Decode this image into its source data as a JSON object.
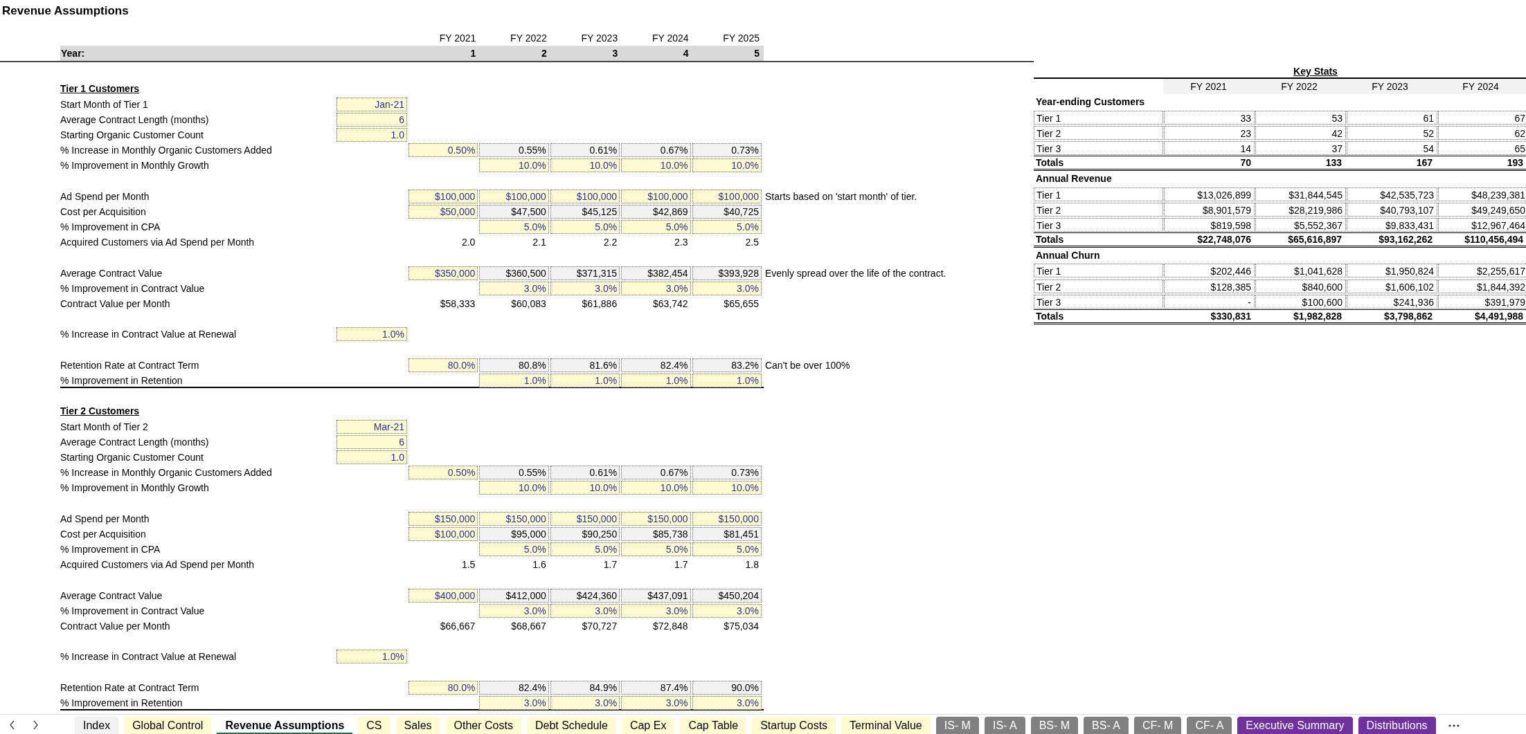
{
  "title": "Revenue Assumptions",
  "header": {
    "year_label": "Year:",
    "columns": [
      {
        "fy": "FY 2021",
        "year": "1"
      },
      {
        "fy": "FY 2022",
        "year": "2"
      },
      {
        "fy": "FY 2023",
        "year": "3"
      },
      {
        "fy": "FY 2024",
        "year": "4"
      },
      {
        "fy": "FY 2025",
        "year": "5"
      }
    ]
  },
  "sections": [
    {
      "title": "Tier 1 Customers",
      "groups": [
        [
          {
            "kind": "setting",
            "label": "Start Month of Tier 1",
            "setting": {
              "text": "Jan-21",
              "kind": "input"
            }
          },
          {
            "kind": "setting",
            "label": "Average Contract Length (months)",
            "setting": {
              "text": "6",
              "kind": "input"
            }
          },
          {
            "kind": "setting",
            "label": "Starting Organic Customer Count",
            "setting": {
              "text": "1.0",
              "kind": "input"
            }
          },
          {
            "kind": "series",
            "label": "% Increase in Monthly Organic Customers Added",
            "values": [
              {
                "text": "0.50%",
                "kind": "input"
              },
              {
                "text": "0.55%",
                "kind": "formula"
              },
              {
                "text": "0.61%",
                "kind": "formula"
              },
              {
                "text": "0.67%",
                "kind": "formula"
              },
              {
                "text": "0.73%",
                "kind": "formula"
              }
            ]
          },
          {
            "kind": "growth",
            "label": "% Improvement in Monthly Growth",
            "values": [
              {
                "text": "10.0%",
                "kind": "input"
              },
              {
                "text": "10.0%",
                "kind": "input"
              },
              {
                "text": "10.0%",
                "kind": "input"
              },
              {
                "text": "10.0%",
                "kind": "input"
              }
            ]
          }
        ],
        [
          {
            "kind": "series",
            "label": "Ad Spend per Month",
            "values": [
              {
                "text": "$100,000",
                "kind": "input"
              },
              {
                "text": "$100,000",
                "kind": "input"
              },
              {
                "text": "$100,000",
                "kind": "input"
              },
              {
                "text": "$100,000",
                "kind": "input"
              },
              {
                "text": "$100,000",
                "kind": "input"
              }
            ],
            "note": "Starts based on 'start month' of tier."
          },
          {
            "kind": "series",
            "label": "Cost per Acquisition",
            "values": [
              {
                "text": "$50,000",
                "kind": "input"
              },
              {
                "text": "$47,500",
                "kind": "formula"
              },
              {
                "text": "$45,125",
                "kind": "formula"
              },
              {
                "text": "$42,869",
                "kind": "formula"
              },
              {
                "text": "$40,725",
                "kind": "formula"
              }
            ]
          },
          {
            "kind": "growth",
            "label": "% Improvement in CPA",
            "values": [
              {
                "text": "5.0%",
                "kind": "input"
              },
              {
                "text": "5.0%",
                "kind": "input"
              },
              {
                "text": "5.0%",
                "kind": "input"
              },
              {
                "text": "5.0%",
                "kind": "input"
              }
            ]
          },
          {
            "kind": "series",
            "label": "Acquired Customers via Ad Spend per Month",
            "values": [
              {
                "text": "2.0",
                "kind": "output"
              },
              {
                "text": "2.1",
                "kind": "output"
              },
              {
                "text": "2.2",
                "kind": "output"
              },
              {
                "text": "2.3",
                "kind": "output"
              },
              {
                "text": "2.5",
                "kind": "output"
              }
            ]
          }
        ],
        [
          {
            "kind": "series",
            "label": "Average Contract Value",
            "values": [
              {
                "text": "$350,000",
                "kind": "input"
              },
              {
                "text": "$360,500",
                "kind": "formula"
              },
              {
                "text": "$371,315",
                "kind": "formula"
              },
              {
                "text": "$382,454",
                "kind": "formula"
              },
              {
                "text": "$393,928",
                "kind": "formula"
              }
            ],
            "note": "Evenly spread over the life of the contract."
          },
          {
            "kind": "growth",
            "label": "% Improvement in Contract Value",
            "values": [
              {
                "text": "3.0%",
                "kind": "input"
              },
              {
                "text": "3.0%",
                "kind": "input"
              },
              {
                "text": "3.0%",
                "kind": "input"
              },
              {
                "text": "3.0%",
                "kind": "input"
              }
            ]
          },
          {
            "kind": "series",
            "label": "Contract Value per Month",
            "values": [
              {
                "text": "$58,333",
                "kind": "output"
              },
              {
                "text": "$60,083",
                "kind": "output"
              },
              {
                "text": "$61,886",
                "kind": "output"
              },
              {
                "text": "$63,742",
                "kind": "output"
              },
              {
                "text": "$65,655",
                "kind": "output"
              }
            ]
          }
        ],
        [
          {
            "kind": "setting",
            "label": "% Increase in Contract Value at Renewal",
            "setting": {
              "text": "1.0%",
              "kind": "input"
            }
          }
        ],
        [
          {
            "kind": "series",
            "label": "Retention Rate at Contract Term",
            "values": [
              {
                "text": "80.0%",
                "kind": "input"
              },
              {
                "text": "80.8%",
                "kind": "formula"
              },
              {
                "text": "81.6%",
                "kind": "formula"
              },
              {
                "text": "82.4%",
                "kind": "formula"
              },
              {
                "text": "83.2%",
                "kind": "formula"
              }
            ],
            "note": "Can't be over 100%"
          },
          {
            "kind": "growth",
            "label": "% Improvement in Retention",
            "values": [
              {
                "text": "1.0%",
                "kind": "input"
              },
              {
                "text": "1.0%",
                "kind": "input"
              },
              {
                "text": "1.0%",
                "kind": "input"
              },
              {
                "text": "1.0%",
                "kind": "input"
              }
            ]
          }
        ]
      ]
    },
    {
      "title": "Tier 2 Customers",
      "groups": [
        [
          {
            "kind": "setting",
            "label": "Start Month of Tier 2",
            "setting": {
              "text": "Mar-21",
              "kind": "input"
            }
          },
          {
            "kind": "setting",
            "label": "Average Contract Length (months)",
            "setting": {
              "text": "6",
              "kind": "input"
            }
          },
          {
            "kind": "setting",
            "label": "Starting Organic Customer Count",
            "setting": {
              "text": "1.0",
              "kind": "input"
            }
          },
          {
            "kind": "series",
            "label": "% Increase in Monthly Organic Customers Added",
            "values": [
              {
                "text": "0.50%",
                "kind": "input"
              },
              {
                "text": "0.55%",
                "kind": "formula"
              },
              {
                "text": "0.61%",
                "kind": "formula"
              },
              {
                "text": "0.67%",
                "kind": "formula"
              },
              {
                "text": "0.73%",
                "kind": "formula"
              }
            ]
          },
          {
            "kind": "growth",
            "label": "% Improvement in Monthly Growth",
            "values": [
              {
                "text": "10.0%",
                "kind": "input"
              },
              {
                "text": "10.0%",
                "kind": "input"
              },
              {
                "text": "10.0%",
                "kind": "input"
              },
              {
                "text": "10.0%",
                "kind": "input"
              }
            ]
          }
        ],
        [
          {
            "kind": "series",
            "label": "Ad Spend per Month",
            "values": [
              {
                "text": "$150,000",
                "kind": "input"
              },
              {
                "text": "$150,000",
                "kind": "input"
              },
              {
                "text": "$150,000",
                "kind": "input"
              },
              {
                "text": "$150,000",
                "kind": "input"
              },
              {
                "text": "$150,000",
                "kind": "input"
              }
            ]
          },
          {
            "kind": "series",
            "label": "Cost per Acquisition",
            "values": [
              {
                "text": "$100,000",
                "kind": "input"
              },
              {
                "text": "$95,000",
                "kind": "formula"
              },
              {
                "text": "$90,250",
                "kind": "formula"
              },
              {
                "text": "$85,738",
                "kind": "formula"
              },
              {
                "text": "$81,451",
                "kind": "formula"
              }
            ]
          },
          {
            "kind": "growth",
            "label": "% Improvement in CPA",
            "values": [
              {
                "text": "5.0%",
                "kind": "input"
              },
              {
                "text": "5.0%",
                "kind": "input"
              },
              {
                "text": "5.0%",
                "kind": "input"
              },
              {
                "text": "5.0%",
                "kind": "input"
              }
            ]
          },
          {
            "kind": "series",
            "label": "Acquired Customers via Ad Spend per Month",
            "values": [
              {
                "text": "1.5",
                "kind": "output"
              },
              {
                "text": "1.6",
                "kind": "output"
              },
              {
                "text": "1.7",
                "kind": "output"
              },
              {
                "text": "1.7",
                "kind": "output"
              },
              {
                "text": "1.8",
                "kind": "output"
              }
            ]
          }
        ],
        [
          {
            "kind": "series",
            "label": "Average Contract Value",
            "values": [
              {
                "text": "$400,000",
                "kind": "input"
              },
              {
                "text": "$412,000",
                "kind": "formula"
              },
              {
                "text": "$424,360",
                "kind": "formula"
              },
              {
                "text": "$437,091",
                "kind": "formula"
              },
              {
                "text": "$450,204",
                "kind": "formula"
              }
            ]
          },
          {
            "kind": "growth",
            "label": "% Improvement in Contract Value",
            "values": [
              {
                "text": "3.0%",
                "kind": "input"
              },
              {
                "text": "3.0%",
                "kind": "input"
              },
              {
                "text": "3.0%",
                "kind": "input"
              },
              {
                "text": "3.0%",
                "kind": "input"
              }
            ]
          },
          {
            "kind": "series",
            "label": "Contract Value per Month",
            "values": [
              {
                "text": "$66,667",
                "kind": "output"
              },
              {
                "text": "$68,667",
                "kind": "output"
              },
              {
                "text": "$70,727",
                "kind": "output"
              },
              {
                "text": "$72,848",
                "kind": "output"
              },
              {
                "text": "$75,034",
                "kind": "output"
              }
            ]
          }
        ],
        [
          {
            "kind": "setting",
            "label": "% Increase in Contract Value at Renewal",
            "setting": {
              "text": "1.0%",
              "kind": "input"
            }
          }
        ],
        [
          {
            "kind": "series",
            "label": "Retention Rate at Contract Term",
            "values": [
              {
                "text": "80.0%",
                "kind": "input"
              },
              {
                "text": "82.4%",
                "kind": "formula"
              },
              {
                "text": "84.9%",
                "kind": "formula"
              },
              {
                "text": "87.4%",
                "kind": "formula"
              },
              {
                "text": "90.0%",
                "kind": "formula"
              }
            ]
          },
          {
            "kind": "growth",
            "label": "% Improvement in Retention",
            "values": [
              {
                "text": "3.0%",
                "kind": "input"
              },
              {
                "text": "3.0%",
                "kind": "input"
              },
              {
                "text": "3.0%",
                "kind": "input"
              },
              {
                "text": "3.0%",
                "kind": "input"
              }
            ]
          }
        ]
      ]
    }
  ],
  "key_stats": {
    "title": "Key Stats",
    "columns": [
      "FY 2021",
      "FY 2022",
      "FY 2023",
      "FY 2024"
    ],
    "groups": [
      {
        "title": "Year-ending Customers",
        "rows": [
          {
            "label": "Tier 1",
            "values": [
              "33",
              "53",
              "61",
              "67"
            ]
          },
          {
            "label": "Tier 2",
            "values": [
              "23",
              "42",
              "52",
              "62"
            ]
          },
          {
            "label": "Tier 3",
            "values": [
              "14",
              "37",
              "54",
              "65"
            ]
          }
        ],
        "total": {
          "label": "Totals",
          "values": [
            "70",
            "133",
            "167",
            "193"
          ]
        }
      },
      {
        "title": "Annual Revenue",
        "rows": [
          {
            "label": "Tier 1",
            "values": [
              "$13,026,899",
              "$31,844,545",
              "$42,535,723",
              "$48,239,381"
            ]
          },
          {
            "label": "Tier 2",
            "values": [
              "$8,901,579",
              "$28,219,986",
              "$40,793,107",
              "$49,249,650"
            ]
          },
          {
            "label": "Tier 3",
            "values": [
              "$819,598",
              "$5,552,367",
              "$9,833,431",
              "$12,967,464"
            ]
          }
        ],
        "total": {
          "label": "Totals",
          "values": [
            "$22,748,076",
            "$65,616,897",
            "$93,162,262",
            "$110,456,494"
          ]
        }
      },
      {
        "title": "Annual Churn",
        "rows": [
          {
            "label": "Tier 1",
            "values": [
              "$202,446",
              "$1,041,628",
              "$1,950,824",
              "$2,255,617"
            ]
          },
          {
            "label": "Tier 2",
            "values": [
              "$128,385",
              "$840,600",
              "$1,606,102",
              "$1,844,392"
            ]
          },
          {
            "label": "Tier 3",
            "values": [
              "-",
              "$100,600",
              "$241,936",
              "$391,979"
            ]
          }
        ],
        "total": {
          "label": "Totals",
          "values": [
            "$330,831",
            "$1,982,828",
            "$3,798,862",
            "$4,491,988"
          ]
        }
      }
    ]
  },
  "tabs": [
    {
      "label": "Index",
      "selected": false,
      "color": "#f2f2f2"
    },
    {
      "label": "Global Control",
      "selected": false,
      "color": "#fefbd0"
    },
    {
      "label": "Revenue Assumptions",
      "selected": true
    },
    {
      "label": "CS",
      "selected": false,
      "color": "#fefbd0"
    },
    {
      "label": "Sales",
      "selected": false,
      "color": "#fefbd0"
    },
    {
      "label": "Other Costs",
      "selected": false,
      "color": "#fefbd0"
    },
    {
      "label": "Debt Schedule",
      "selected": false,
      "color": "#fefbd0"
    },
    {
      "label": "Cap Ex",
      "selected": false,
      "color": "#fefbd0"
    },
    {
      "label": "Cap Table",
      "selected": false,
      "color": "#fefbd0"
    },
    {
      "label": "Startup Costs",
      "selected": false,
      "color": "#fefbd0"
    },
    {
      "label": "Terminal Value",
      "selected": false,
      "color": "#fefbd0"
    },
    {
      "label": "IS- M",
      "selected": false,
      "color": "#808080"
    },
    {
      "label": "IS- A",
      "selected": false,
      "color": "#808080"
    },
    {
      "label": "BS- M",
      "selected": false,
      "color": "#808080"
    },
    {
      "label": "BS- A",
      "selected": false,
      "color": "#808080"
    },
    {
      "label": "CF- M",
      "selected": false,
      "color": "#808080"
    },
    {
      "label": "CF- A",
      "selected": false,
      "color": "#808080"
    },
    {
      "label": "Executive Summary",
      "selected": false,
      "color": "#7030a0"
    },
    {
      "label": "Distributions",
      "selected": false,
      "color": "#7030a0"
    }
  ]
}
